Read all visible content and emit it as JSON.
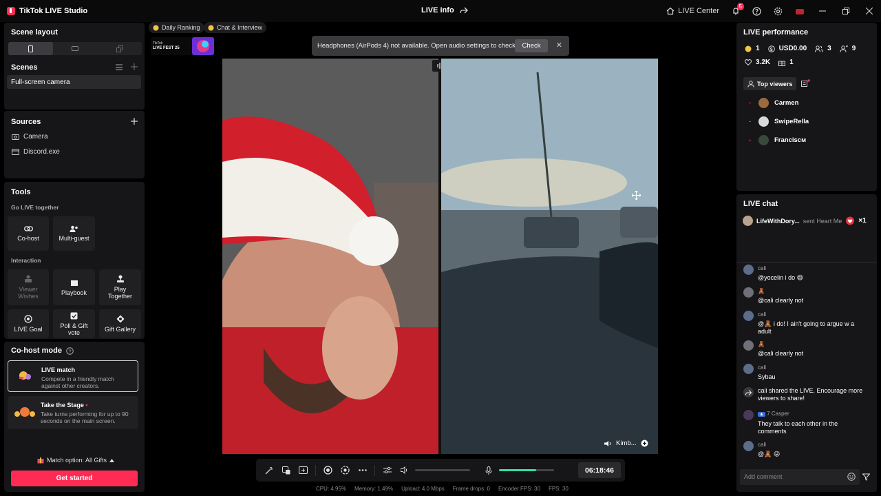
{
  "app": {
    "title": "TikTok LIVE Studio"
  },
  "titlebar": {
    "center_title": "LIVE info",
    "live_center_label": "LIVE Center",
    "notification_count": "5"
  },
  "scene_layout": {
    "title": "Scene layout"
  },
  "scenes": {
    "title": "Scenes",
    "items": [
      "Full-screen camera"
    ]
  },
  "sources": {
    "title": "Sources",
    "items": [
      "Camera",
      "Discord.exe"
    ]
  },
  "tools": {
    "title": "Tools",
    "go_live_together": "Go LIVE together",
    "cohost": "Co-host",
    "multiguest": "Multi-guest",
    "interaction": "Interaction",
    "viewer_wishes": "Viewer Wishes",
    "playbook": "Playbook",
    "play_together": "Play Together",
    "live_goal": "LIVE Goal",
    "poll_gift_vote": "Poll & Gift vote",
    "gift_gallery": "Gift Gallery"
  },
  "cohost_mode": {
    "title": "Co-host mode",
    "live_match_title": "LIVE match",
    "live_match_desc": "Compete in a friendly match against other creators.",
    "take_stage_title": "Take the Stage",
    "take_stage_desc": "Take turns performing for up to 90 seconds on the main screen.",
    "match_option": "Match option: All Gifts",
    "get_started": "Get started"
  },
  "center": {
    "daily_ranking": "Daily Ranking",
    "chat_interview": "Chat & Interview",
    "fest_label_top": "TikTok",
    "fest_label_bottom": "LIVE FEST 25",
    "toast_text": "Headphones (AirPods 4) not available. Open audio settings to check.",
    "toast_button": "Check",
    "guest_name": "Kimb...",
    "timer": "06:18:46",
    "mic_level": 0.68,
    "stats": {
      "cpu": "CPU:  4.95%",
      "memory": "Memory:  1.49%",
      "upload": "Upload:  4.0 Mbps",
      "frame_drops": "Frame drops:  0",
      "encoder_fps": "Encoder FPS:  30",
      "fps": "FPS:  30"
    }
  },
  "performance": {
    "title": "LIVE performance",
    "coins": "1",
    "usd": "USD0.00",
    "viewers": "3",
    "followers": "9",
    "likes": "3.2K",
    "gifts": "1",
    "top_viewers_label": "Top viewers",
    "top_viewers": [
      {
        "rank": "-",
        "name": "Carmen"
      },
      {
        "rank": "-",
        "name": "SwipeRella"
      },
      {
        "rank": "-",
        "name": "Francisᴄᴍ"
      }
    ]
  },
  "chat": {
    "title": "LIVE chat",
    "gift_user": "LifeWithDory...",
    "gift_text": "sent Heart Me",
    "gift_count": "×1",
    "messages": [
      {
        "name": "cali",
        "text": "@yocelin i do 😄"
      },
      {
        "name": "🧸",
        "text": "@cali clearly not"
      },
      {
        "name": "cali",
        "text": "@🧸 i do! I ain't going to argue w a adult"
      },
      {
        "name": "🧸",
        "text": "@cali clearly not"
      },
      {
        "name": "cali",
        "text": "Sybau"
      },
      {
        "name": "",
        "text": "cali shared the LIVE. Encourage more viewers to share!"
      },
      {
        "name": "7  Casper",
        "text": "They talk to each other in the comments"
      },
      {
        "name": "cali",
        "text": "@🧸 😝"
      }
    ],
    "add_comment_placeholder": "Add comment"
  },
  "colors": {
    "accent": "#fe2c55",
    "level_green": "#2fe0a0"
  }
}
